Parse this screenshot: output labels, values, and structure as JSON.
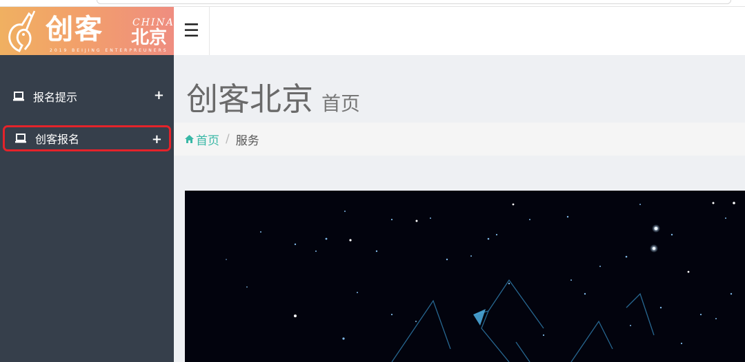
{
  "logo": {
    "main_text": "创客",
    "sub_top": "CHINA",
    "sub_bottom": "北京",
    "tagline": "2019 BEIJING ENTERPREUNERS"
  },
  "sidebar": {
    "items": [
      {
        "label": "报名提示",
        "icon": "laptop-icon",
        "expand": "+"
      },
      {
        "label": "创客报名",
        "icon": "laptop-icon",
        "expand": "+",
        "highlighted": true
      }
    ]
  },
  "header": {
    "menu_icon": "hamburger-icon",
    "menu_glyph": "☰"
  },
  "main": {
    "title": "创客北京",
    "subtitle": "首页",
    "breadcrumb": {
      "home": "首页",
      "separator": "/",
      "current": "服务"
    }
  },
  "colors": {
    "sidebar_bg": "#363f4b",
    "content_bg": "#eef0f3",
    "breadcrumb_link": "#39b8a6",
    "highlight_border": "#e5232a",
    "banner_bg": "#02030d"
  }
}
